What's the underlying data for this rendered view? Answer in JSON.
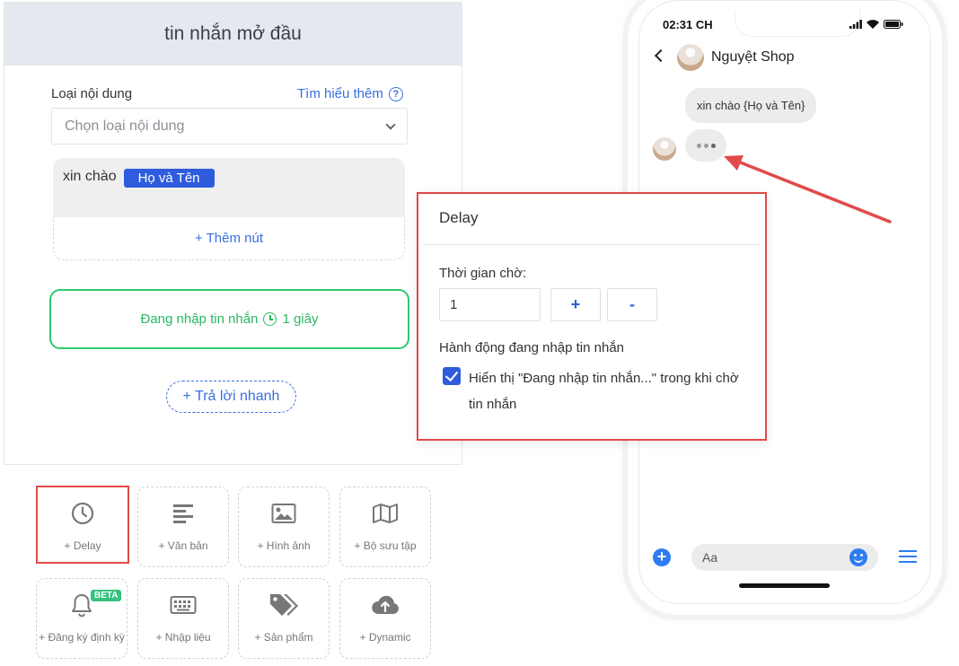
{
  "editor": {
    "title": "tin nhắn mở đầu",
    "content_type_label": "Loại nội dung",
    "learn_more": "Tìm hiểu thêm",
    "help_symbol": "?",
    "select_placeholder": "Chọn loại nội dung",
    "message_prefix": "xin chào",
    "name_tag": "Họ và Tên",
    "add_button": "+ Thêm nút",
    "typing_text": "Đang nhập tin nhắn",
    "typing_duration": "1 giây",
    "quick_reply": "+ Trả lời nhanh"
  },
  "tools": [
    {
      "label": "+ Delay",
      "icon": "clock-icon",
      "selected": true
    },
    {
      "label": "+ Văn bản",
      "icon": "text-lines-icon",
      "selected": false
    },
    {
      "label": "+ Hình ảnh",
      "icon": "image-icon",
      "selected": false
    },
    {
      "label": "+ Bộ sưu tập",
      "icon": "map-gallery-icon",
      "selected": false
    },
    {
      "label": "+ Đăng ký định kỳ",
      "icon": "bell-icon",
      "badge": "BETA",
      "selected": false
    },
    {
      "label": "+ Nhập liệu",
      "icon": "keyboard-icon",
      "selected": false
    },
    {
      "label": "+ Sản phẩm",
      "icon": "tags-icon",
      "selected": false
    },
    {
      "label": "+ Dynamic",
      "icon": "cloud-upload-icon",
      "selected": false
    }
  ],
  "delay_panel": {
    "title": "Delay",
    "wait_label": "Thời gian chờ:",
    "wait_value": "1",
    "plus": "+",
    "minus": "-",
    "action_label": "Hành động đang nhập tin nhắn",
    "checkbox_checked": true,
    "checkbox_text": "Hiển thị \"Đang nhập tin nhắn...\" trong khi chờ tin nhắn"
  },
  "phone": {
    "time": "02:31 CH",
    "shop_name": "Nguyệt Shop",
    "message": "xin chào {Họ và Tên}",
    "composer_placeholder": "Aa"
  },
  "colors": {
    "accent_blue": "#2e5cdc",
    "link_blue": "#3a6fe0",
    "green": "#27b860",
    "highlight_red": "#e24a4a",
    "messenger_blue": "#2f7cf0"
  }
}
